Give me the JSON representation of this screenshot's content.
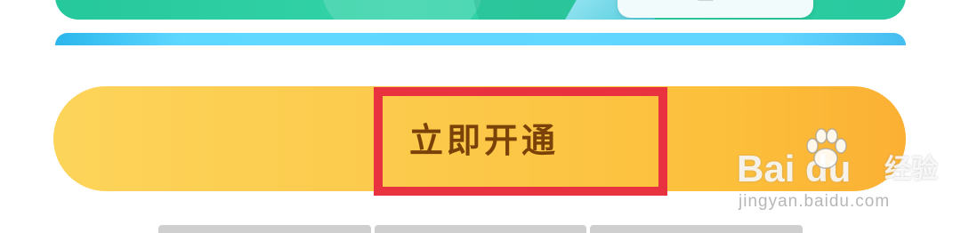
{
  "promo": {
    "icon": "promo-illustration"
  },
  "activate_button": {
    "label": "立即开通",
    "color_start": "#fdd45a",
    "color_end": "#fbb034",
    "text_color": "#7a4208"
  },
  "highlight": {
    "color": "#e8323f"
  },
  "watermark": {
    "logo": "Bai du",
    "sub": "经验",
    "url": "jingyan.baidu.com",
    "icon": "paw-icon"
  },
  "tabs": {
    "count": 3
  }
}
